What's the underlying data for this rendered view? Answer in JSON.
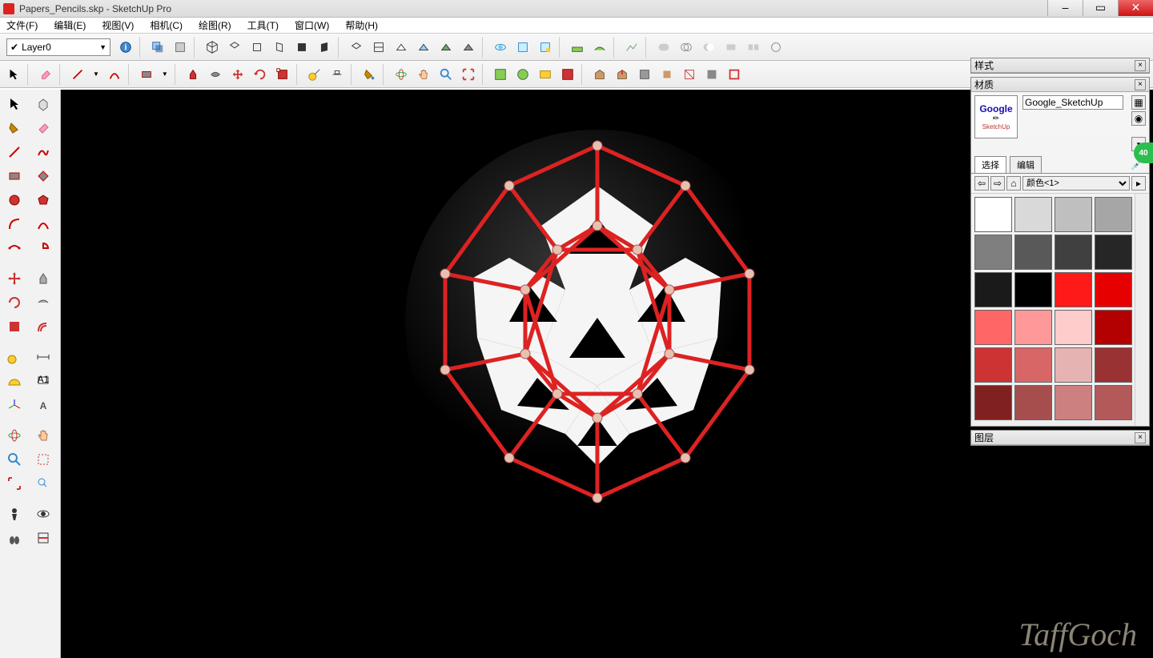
{
  "window": {
    "title": "Papers_Pencils.skp - SketchUp Pro"
  },
  "menu": {
    "file": "文件(F)",
    "edit": "编辑(E)",
    "view": "视图(V)",
    "camera": "相机(C)",
    "draw": "绘图(R)",
    "tools": "工具(T)",
    "window": "窗口(W)",
    "help": "帮助(H)"
  },
  "layer": {
    "current": "Layer0"
  },
  "panels": {
    "styles_title": "样式",
    "materials_title": "材质",
    "material_name": "Google_SketchUp",
    "thumb_line1": "Google",
    "thumb_line2": "SketchUp",
    "tab_select": "选择",
    "tab_edit": "编辑",
    "palette_name": "颜色<1>",
    "layers_title": "图层"
  },
  "swatch_colors": [
    "#ffffff",
    "#d9d9d9",
    "#bfbfbf",
    "#a6a6a6",
    "#7f7f7f",
    "#595959",
    "#404040",
    "#262626",
    "#1a1a1a",
    "#000000",
    "#ff1a1a",
    "#e60000",
    "#ff6666",
    "#ff9999",
    "#ffcccc",
    "#b30000",
    "#cc3333",
    "#d96666",
    "#e6b3b3",
    "#993333",
    "#802020",
    "#a64d4d",
    "#cc8080",
    "#b35959"
  ],
  "badge": "40",
  "watermark": "TaffGoch"
}
